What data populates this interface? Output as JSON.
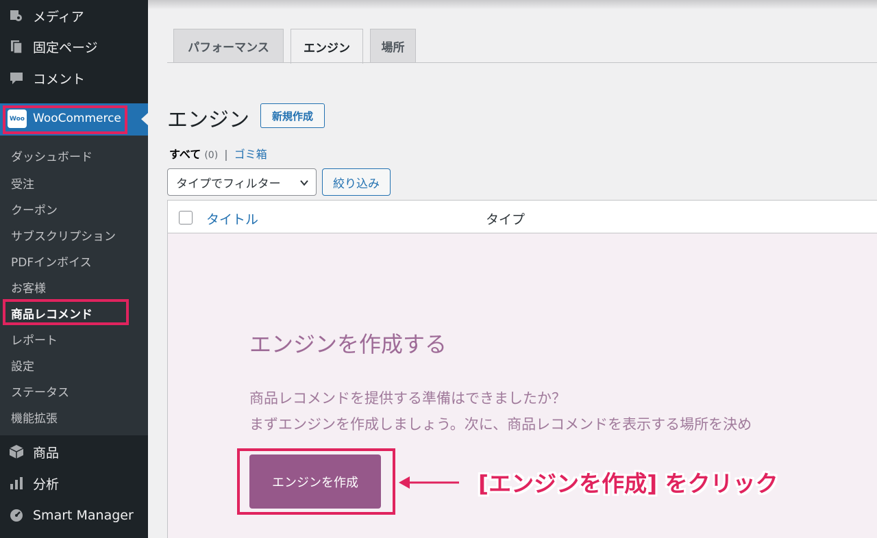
{
  "sidebar": {
    "top_items": [
      {
        "label": "メディア",
        "icon": "media-icon"
      },
      {
        "label": "固定ページ",
        "icon": "pages-icon"
      },
      {
        "label": "コメント",
        "icon": "comments-icon"
      }
    ],
    "woocommerce": {
      "label": "WooCommerce",
      "logo_text": "Woo"
    },
    "submenu": [
      {
        "label": "ダッシュボード"
      },
      {
        "label": "受注"
      },
      {
        "label": "クーポン"
      },
      {
        "label": "サブスクリプション"
      },
      {
        "label": "PDFインボイス"
      },
      {
        "label": "お客様"
      },
      {
        "label": "商品レコメンド",
        "current": true
      },
      {
        "label": "レポート"
      },
      {
        "label": "設定"
      },
      {
        "label": "ステータス"
      },
      {
        "label": "機能拡張"
      }
    ],
    "bottom_items": [
      {
        "label": "商品",
        "icon": "products-icon"
      },
      {
        "label": "分析",
        "icon": "analytics-icon"
      },
      {
        "label": "Smart Manager",
        "icon": "smart-manager-icon"
      }
    ]
  },
  "tabs": [
    {
      "label": "パフォーマンス"
    },
    {
      "label": "エンジン",
      "active": true
    },
    {
      "label": "場所"
    }
  ],
  "page": {
    "title": "エンジン",
    "new_button": "新規作成"
  },
  "views": {
    "all_label": "すべて",
    "all_count": "(0)",
    "separator": "|",
    "trash_label": "ゴミ箱"
  },
  "filter": {
    "type_placeholder": "タイプでフィルター",
    "button": "絞り込み"
  },
  "table": {
    "columns": [
      "タイトル",
      "タイプ"
    ]
  },
  "empty_state": {
    "heading": "エンジンを作成する",
    "line1": "商品レコメンドを提供する準備はできましたか？",
    "line2": "まずエンジンを作成しましょう。次に、商品レコメンドを表示する場所を決め",
    "button": "エンジンを作成"
  },
  "annotation": {
    "text": "[エンジンを作成] をクリック",
    "color": "#e0245e"
  },
  "colors": {
    "sidebar_bg": "#1d2327",
    "submenu_bg": "#2c3338",
    "accent_blue": "#2271b1",
    "woo_purple": "#96588a",
    "highlight_red": "#e0245e"
  }
}
